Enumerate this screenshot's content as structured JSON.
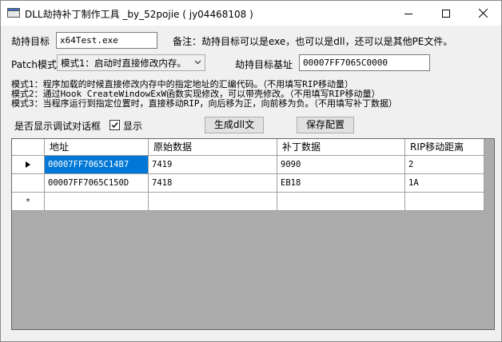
{
  "window": {
    "title": "DLL劫持补丁制作工具 _by_52pojie ( jy04468108 )"
  },
  "form": {
    "target_label": "劫持目标",
    "target_value": "x64Test.exe",
    "note_text": "备注：劫持目标可以是exe，也可以是dll，还可以是其他PE文件。",
    "patch_mode_label": "Patch模式",
    "patch_mode_value": "模式1：启动时直接修改内存。",
    "base_label": "劫持目标基址",
    "base_value": "00007FF7065C0000",
    "mode1_desc": "模式1：程序加载的时候直接修改内存中的指定地址的汇编代码。（不用填写RIP移动量）",
    "mode2_desc": "模式2：通过Hook CreateWindowExW函数实现修改，可以带壳修改。（不用填写RIP移动量）",
    "mode3_desc": "模式3：当程序运行到指定位置时，直接移动RIP，向后移为正，向前移为负。（不用填写补丁数据）",
    "debug_label": "是否显示调试对话框",
    "debug_checkbox_label": "显示",
    "debug_checked": true,
    "generate_button": "生成dll文",
    "save_button": "保存配置"
  },
  "grid": {
    "columns": [
      "地址",
      "原始数据",
      "补丁数据",
      "RIP移动距离"
    ],
    "rows": [
      {
        "marker": "▶",
        "address": "00007FF7065C14B7",
        "original": "7419",
        "patch": "9090",
        "rip": "2"
      },
      {
        "marker": "",
        "address": "00007FF7065C150D",
        "original": "7418",
        "patch": "EB18",
        "rip": "1A"
      },
      {
        "marker": "*",
        "address": "",
        "original": "",
        "patch": "",
        "rip": ""
      }
    ]
  },
  "icons": {
    "app": "app-icon",
    "minimize": "minimize-icon",
    "maximize": "maximize-icon",
    "close": "close-icon",
    "dropdown": "chevron-down-icon",
    "check": "checkmark-icon"
  }
}
